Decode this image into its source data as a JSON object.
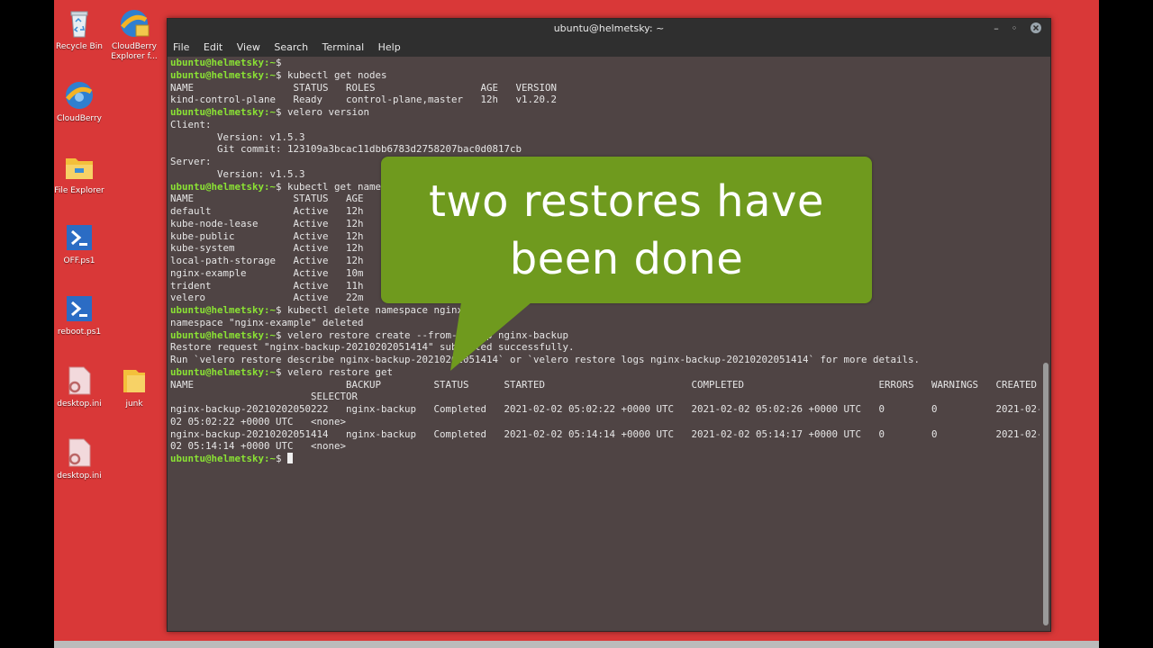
{
  "desktop": {
    "icons": [
      {
        "label": "Recycle Bin",
        "icon": "recycle-bin-icon"
      },
      {
        "label": "CloudBerry Explorer f...",
        "icon": "cloudberry-icon"
      },
      {
        "label": "CloudBerry",
        "icon": "cloudberry-icon"
      },
      {
        "label": "File Explorer",
        "icon": "folder-icon"
      },
      {
        "label": "OFF.ps1",
        "icon": "powershell-icon"
      },
      {
        "label": "reboot.ps1",
        "icon": "powershell-icon"
      },
      {
        "label": "desktop.ini",
        "icon": "settings-file-icon"
      },
      {
        "label": "junk",
        "icon": "folder-icon"
      },
      {
        "label": "desktop.ini",
        "icon": "settings-file-icon"
      }
    ],
    "colors": {
      "background": "#d93838"
    }
  },
  "terminal": {
    "title": "ubuntu@helmetsky: ~",
    "menu": [
      "File",
      "Edit",
      "View",
      "Search",
      "Terminal",
      "Help"
    ],
    "prompt": "ubuntu@helmetsky:~",
    "lines": [
      {
        "p": true,
        "t": ""
      },
      {
        "p": true,
        "t": " kubectl get nodes"
      },
      {
        "p": false,
        "t": "NAME                 STATUS   ROLES                  AGE   VERSION"
      },
      {
        "p": false,
        "t": "kind-control-plane   Ready    control-plane,master   12h   v1.20.2"
      },
      {
        "p": true,
        "t": " velero version"
      },
      {
        "p": false,
        "t": "Client:"
      },
      {
        "p": false,
        "t": "        Version: v1.5.3"
      },
      {
        "p": false,
        "t": "        Git commit: 123109a3bcac11dbb6783d2758207bac0d0817cb"
      },
      {
        "p": false,
        "t": "Server:"
      },
      {
        "p": false,
        "t": "        Version: v1.5.3"
      },
      {
        "p": true,
        "t": " kubectl get namespaces"
      },
      {
        "p": false,
        "t": "NAME                 STATUS   AGE"
      },
      {
        "p": false,
        "t": "default              Active   12h"
      },
      {
        "p": false,
        "t": "kube-node-lease      Active   12h"
      },
      {
        "p": false,
        "t": "kube-public          Active   12h"
      },
      {
        "p": false,
        "t": "kube-system          Active   12h"
      },
      {
        "p": false,
        "t": "local-path-storage   Active   12h"
      },
      {
        "p": false,
        "t": "nginx-example        Active   10m"
      },
      {
        "p": false,
        "t": "trident              Active   11h"
      },
      {
        "p": false,
        "t": "velero               Active   22m"
      },
      {
        "p": true,
        "t": " kubectl delete namespace nginx-example"
      },
      {
        "p": false,
        "t": "namespace \"nginx-example\" deleted"
      },
      {
        "p": true,
        "t": " velero restore create --from-backup nginx-backup"
      },
      {
        "p": false,
        "t": "Restore request \"nginx-backup-20210202051414\" submitted successfully."
      },
      {
        "p": false,
        "t": "Run `velero restore describe nginx-backup-20210202051414` or `velero restore logs nginx-backup-20210202051414` for more details."
      },
      {
        "p": true,
        "t": " velero restore get"
      },
      {
        "p": false,
        "t": "NAME                          BACKUP         STATUS      STARTED                         COMPLETED                       ERRORS   WARNINGS   CREATED"
      },
      {
        "p": false,
        "t": "                        SELECTOR"
      },
      {
        "p": false,
        "t": "nginx-backup-20210202050222   nginx-backup   Completed   2021-02-02 05:02:22 +0000 UTC   2021-02-02 05:02:26 +0000 UTC   0        0          2021-02-"
      },
      {
        "p": false,
        "t": "02 05:02:22 +0000 UTC   <none>"
      },
      {
        "p": false,
        "t": "nginx-backup-20210202051414   nginx-backup   Completed   2021-02-02 05:14:14 +0000 UTC   2021-02-02 05:14:17 +0000 UTC   0        0          2021-02-"
      },
      {
        "p": false,
        "t": "02 05:14:14 +0000 UTC   <none>"
      },
      {
        "p": true,
        "t": " ",
        "cursor": true
      }
    ],
    "colors": {
      "background": "#4f4444",
      "prompt": "#8ae234",
      "text": "#e6e6e6"
    }
  },
  "callout": {
    "text_line1": "two restores have",
    "text_line2": "been done",
    "color": "#6f9a1e"
  }
}
